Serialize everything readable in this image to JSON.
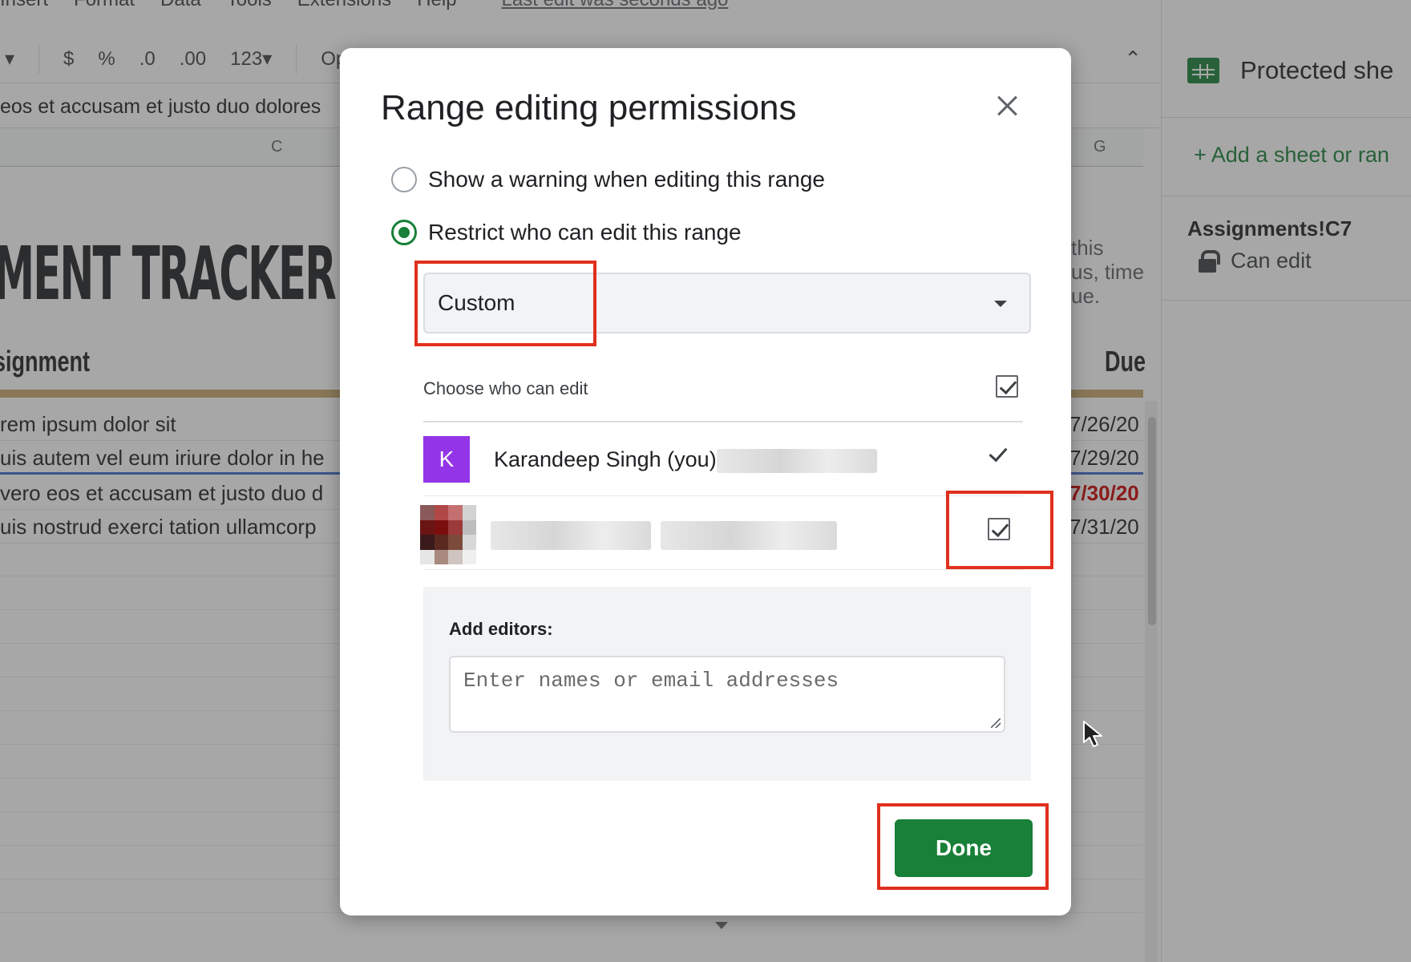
{
  "menubar": {
    "items": [
      "Insert",
      "Format",
      "Data",
      "Tools",
      "Extensions",
      "Help"
    ],
    "last_edit": "Last edit was seconds ago"
  },
  "toolbar": {
    "currency": "$",
    "percent": "%",
    "decrease_decimal": ".0",
    "increase_decimal": ".00",
    "number_format": "123",
    "font_partial": "Op"
  },
  "formula_bar": {
    "text": "eos et accusam et justo duo dolores"
  },
  "columns": {
    "c": "C",
    "g": "G"
  },
  "sheet": {
    "title": "MENT TRACKER",
    "header_assignment": "signment",
    "header_due": "Due",
    "notes": [
      "this",
      "us, time",
      "ue."
    ],
    "rows": [
      {
        "text": "rem ipsum dolor sit",
        "date": "7/26/20"
      },
      {
        "text": "uis autem vel eum iriure dolor in he",
        "date": "7/29/20"
      },
      {
        "text": " vero eos et accusam et justo duo d",
        "date": "7/30/20"
      },
      {
        "text": "uis nostrud exerci tation ullamcorp",
        "date": "7/31/20"
      }
    ]
  },
  "side_panel": {
    "title": "Protected she",
    "add_label": "+ Add a sheet or ran",
    "range_name": "Assignments!C7",
    "range_permission": "Can edit"
  },
  "dialog": {
    "title": "Range editing permissions",
    "option_warning": "Show a warning when editing this range",
    "option_restrict": "Restrict who can edit this range",
    "selected_option": "restrict",
    "dropdown_value": "Custom",
    "choose_label": "Choose who can edit",
    "users": [
      {
        "initial": "K",
        "name": "Karandeep Singh (you)",
        "checked": true,
        "avatar_color": "#9334e6"
      },
      {
        "initial": "",
        "name": "",
        "checked": true
      }
    ],
    "add_editors_label": "Add editors:",
    "add_editors_placeholder": "Enter names or email addresses",
    "done_label": "Done"
  },
  "colors": {
    "accent_green": "#188038",
    "annotation_red": "#e0301e",
    "overdue_red": "#cc0000"
  }
}
